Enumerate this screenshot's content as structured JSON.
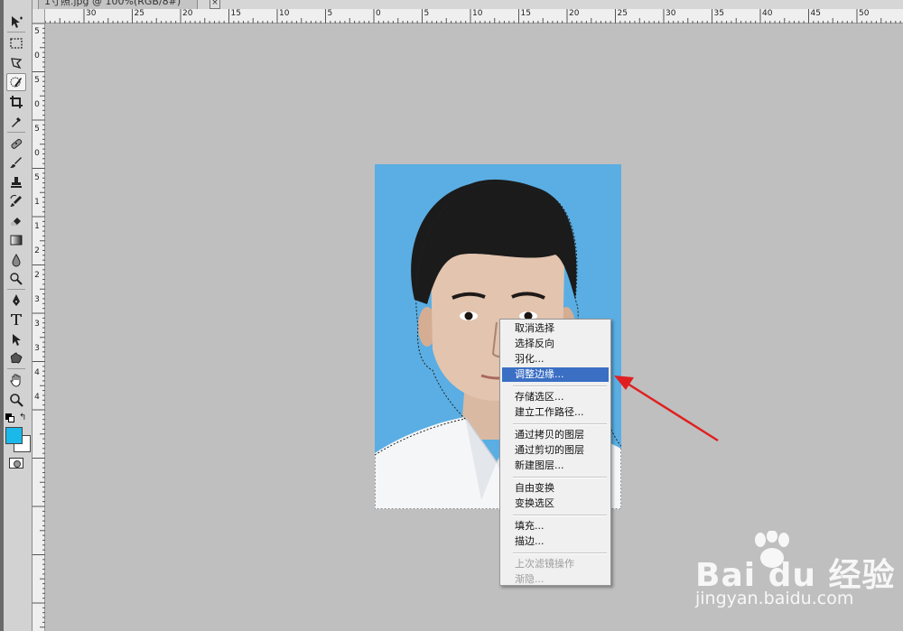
{
  "document_tab": {
    "title": "1寸照.jpg @ 100%(RGB/8#)",
    "close_glyph": "×"
  },
  "tools": [
    {
      "name": "move-tool-icon"
    },
    {
      "name": "marquee-tool-icon"
    },
    {
      "name": "lasso-tool-icon"
    },
    {
      "name": "quick-selection-tool-icon",
      "active": true
    },
    {
      "name": "crop-tool-icon"
    },
    {
      "name": "eyedropper-tool-icon"
    },
    {
      "name": "healing-brush-tool-icon"
    },
    {
      "name": "brush-tool-icon"
    },
    {
      "name": "clone-stamp-tool-icon"
    },
    {
      "name": "history-brush-tool-icon"
    },
    {
      "name": "eraser-tool-icon"
    },
    {
      "name": "gradient-tool-icon"
    },
    {
      "name": "blur-tool-icon"
    },
    {
      "name": "dodge-tool-icon"
    },
    {
      "name": "pen-tool-icon"
    },
    {
      "name": "type-tool-icon"
    },
    {
      "name": "path-selection-tool-icon"
    },
    {
      "name": "custom-shape-tool-icon"
    },
    {
      "name": "hand-tool-icon"
    },
    {
      "name": "zoom-tool-icon"
    }
  ],
  "colors": {
    "foreground": "#1ab9ea",
    "background": "#ffffff",
    "photo_background": "#5aaee3",
    "menu_highlight": "#3a6fc4",
    "arrow": "#e02020"
  },
  "ruler_top_labels": [
    "30",
    "25",
    "20",
    "15",
    "10",
    "5",
    "0",
    "5",
    "10",
    "15",
    "20",
    "25",
    "30",
    "35",
    "40",
    "45",
    "50"
  ],
  "ruler_left_labels": [
    "5",
    "0",
    "5",
    "0",
    "5",
    "0",
    "5",
    "1",
    "1",
    "2",
    "2",
    "3",
    "3",
    "3",
    "4",
    "4"
  ],
  "context_menu": {
    "items": [
      {
        "label": "取消选择"
      },
      {
        "label": "选择反向"
      },
      {
        "label": "羽化..."
      },
      {
        "label": "调整边缘...",
        "selected": true
      },
      {
        "separator": true
      },
      {
        "label": "存储选区..."
      },
      {
        "label": "建立工作路径..."
      },
      {
        "separator": true
      },
      {
        "label": "通过拷贝的图层"
      },
      {
        "label": "通过剪切的图层"
      },
      {
        "label": "新建图层..."
      },
      {
        "separator": true
      },
      {
        "label": "自由变换"
      },
      {
        "label": "变换选区"
      },
      {
        "separator": true
      },
      {
        "label": "填充..."
      },
      {
        "label": "描边..."
      },
      {
        "separator": true
      },
      {
        "label": "上次滤镜操作",
        "disabled": true
      },
      {
        "label": "渐隐...",
        "disabled": true
      }
    ]
  },
  "watermark": {
    "logo_text": "Bai du 经验",
    "url": "jingyan.baidu.com"
  }
}
